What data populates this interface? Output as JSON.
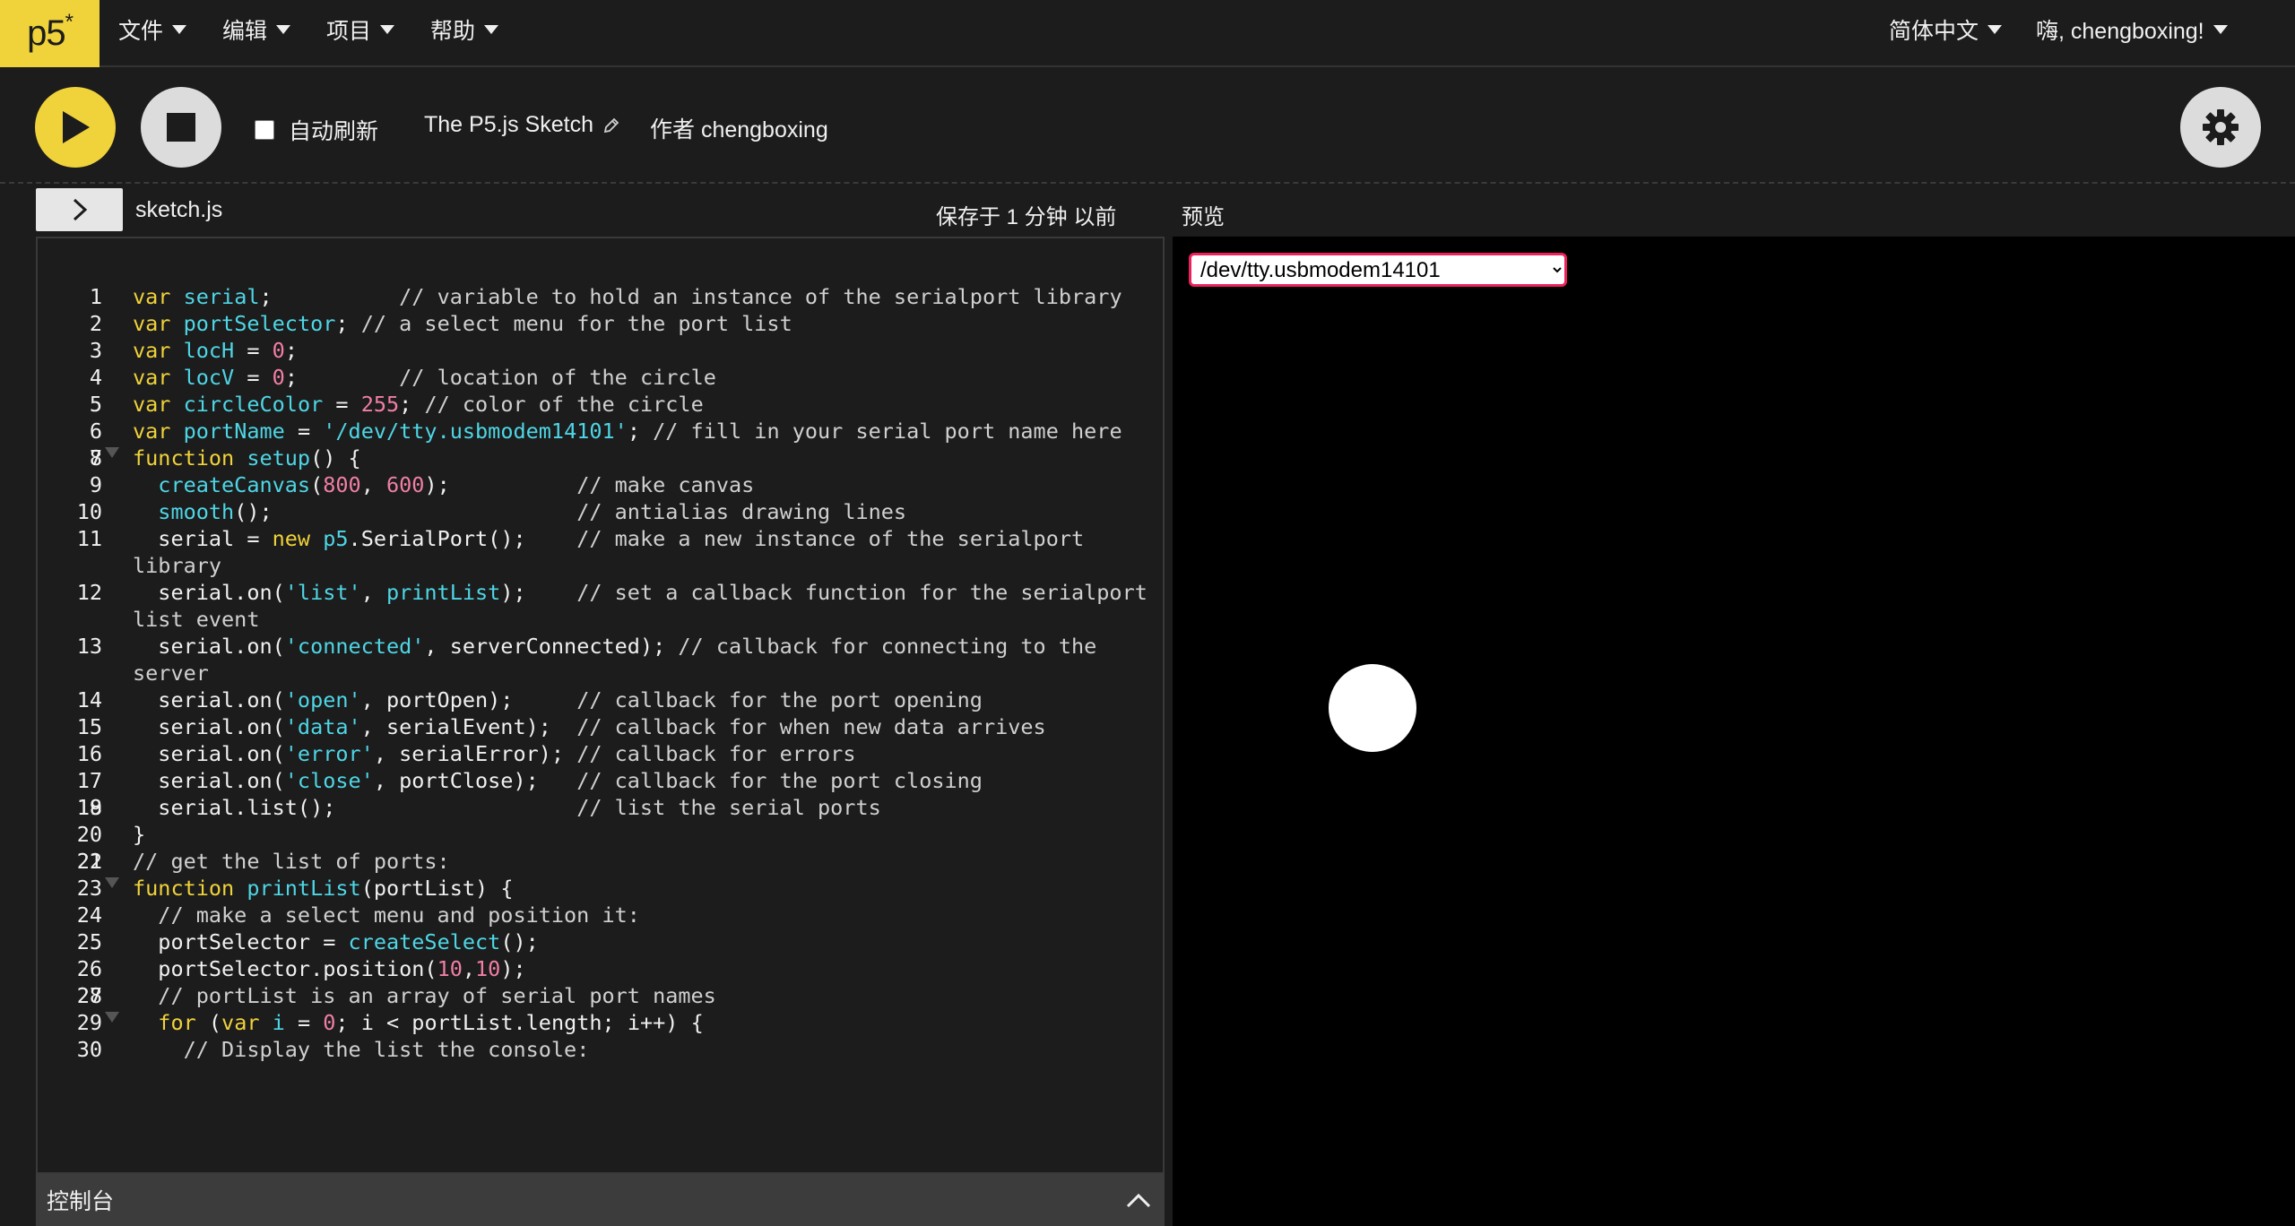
{
  "nav": {
    "logo": "p5",
    "logo_star": "*",
    "menus": [
      "文件",
      "编辑",
      "项目",
      "帮助"
    ],
    "language": "简体中文",
    "user": "嗨, chengboxing!"
  },
  "toolbar": {
    "autorefresh_label": "自动刷新",
    "autorefresh_checked": false,
    "sketch_name": "The P5.js Sketch",
    "author": "作者 chengboxing"
  },
  "editor": {
    "file_name": "sketch.js",
    "saved_status": "保存于 1 分钟 以前",
    "lines": [
      "var serial;          // variable to hold an instance of the serialport library",
      "var portSelector; // a select menu for the port list",
      "var locH = 0;",
      "var locV = 0;        // location of the circle",
      "var circleColor = 255; // color of the circle",
      "var portName = '/dev/tty.usbmodem14101'; // fill in your serial port name here",
      "",
      "function setup() {",
      "  createCanvas(800, 600);          // make canvas",
      "  smooth();                        // antialias drawing lines",
      "  serial = new p5.SerialPort();    // make a new instance of the serialport library",
      "  serial.on('list', printList);    // set a callback function for the serialport list event",
      "  serial.on('connected', serverConnected); // callback for connecting to the server",
      "  serial.on('open', portOpen);     // callback for the port opening",
      "  serial.on('data', serialEvent);  // callback for when new data arrives",
      "  serial.on('error', serialError); // callback for errors",
      "  serial.on('close', portClose);   // callback for the port closing",
      "",
      "  serial.list();                   // list the serial ports",
      "}",
      "",
      "// get the list of ports:",
      "function printList(portList) {",
      "  // make a select menu and position it:",
      "  portSelector = createSelect();",
      "  portSelector.position(10,10);",
      "",
      "  // portList is an array of serial port names",
      "  for (var i = 0; i < portList.length; i++) {",
      "    // Display the list the console:"
    ],
    "fold_lines": [
      8,
      23,
      29
    ]
  },
  "console": {
    "label": "控制台"
  },
  "preview": {
    "label": "预览",
    "selected_port": "/dev/tty.usbmodem14101"
  },
  "colors": {
    "accent": "#f0d23b",
    "keyword": "#f0d23b",
    "identifier": "#4ed6e6",
    "number": "#f07fa4",
    "background": "#1c1c1c"
  }
}
